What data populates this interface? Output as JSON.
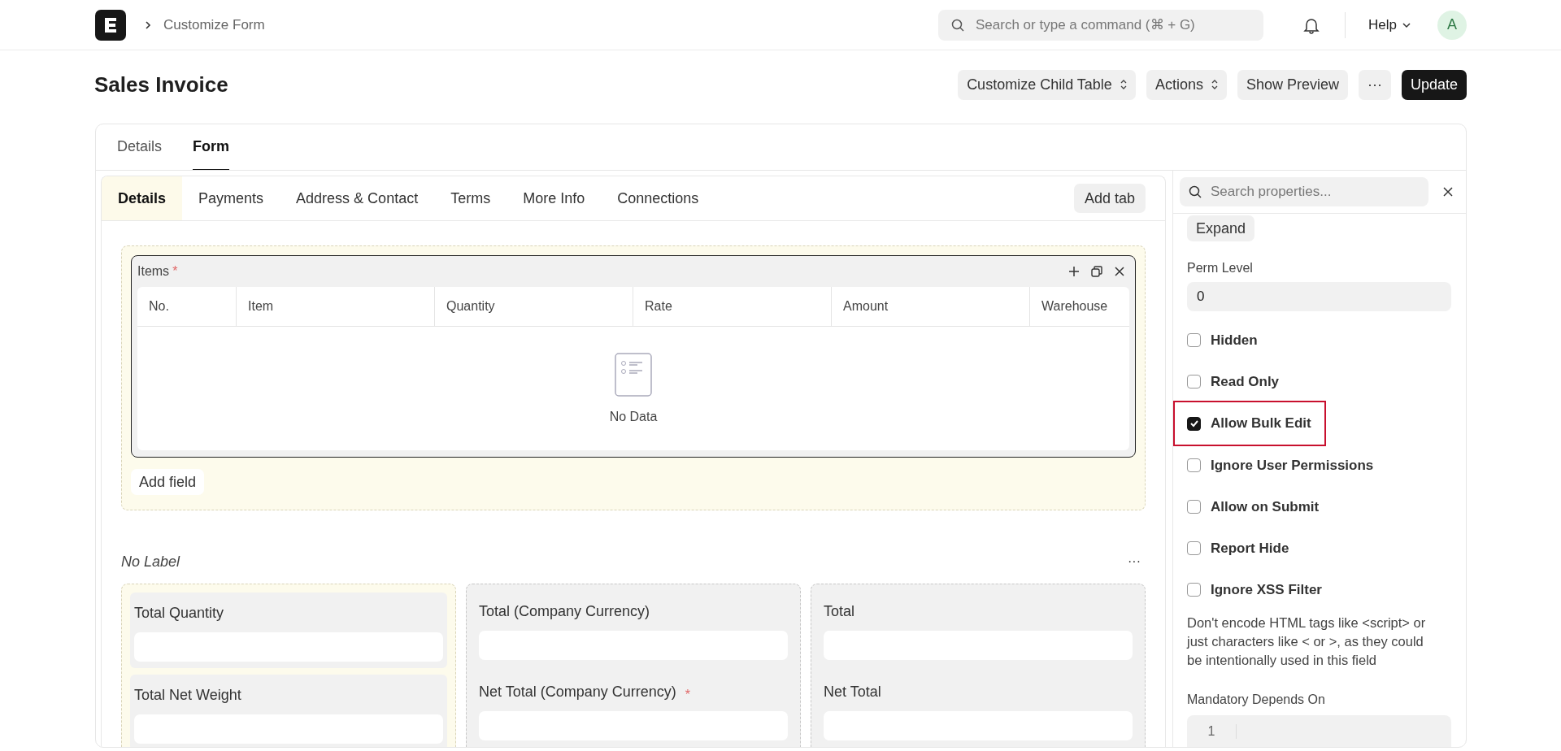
{
  "topbar": {
    "breadcrumb": "Customize Form",
    "search_placeholder": "Search or type a command (⌘ + G)",
    "help": "Help",
    "avatar": "A"
  },
  "header": {
    "title": "Sales Invoice",
    "buttons": [
      {
        "label": "Customize Child Table",
        "kind": "select"
      },
      {
        "label": "Actions",
        "kind": "select"
      },
      {
        "label": "Show Preview",
        "kind": "plain"
      },
      {
        "label": "···",
        "kind": "plain"
      },
      {
        "label": "Update",
        "kind": "primary"
      }
    ]
  },
  "page_tabs": [
    {
      "label": "Details",
      "selected": false
    },
    {
      "label": "Form",
      "selected": true
    }
  ],
  "form_tabs": [
    {
      "label": "Details",
      "selected": true
    },
    {
      "label": "Payments",
      "selected": false
    },
    {
      "label": "Address & Contact",
      "selected": false
    },
    {
      "label": "Terms",
      "selected": false
    },
    {
      "label": "More Info",
      "selected": false
    },
    {
      "label": "Connections",
      "selected": false
    }
  ],
  "add_tab": "Add tab",
  "items_table": {
    "label": "Items",
    "required_mark": "*",
    "columns": [
      "No.",
      "Item",
      "Quantity",
      "Rate",
      "Amount",
      "Warehouse"
    ],
    "empty_text": "No Data"
  },
  "add_field": "Add field",
  "section": {
    "label": "No Label",
    "menu": "···",
    "columns": [
      {
        "selected": true,
        "fields": [
          {
            "label": "Total Quantity"
          },
          {
            "label": "Total Net Weight"
          }
        ]
      },
      {
        "selected": false,
        "fields": [
          {
            "label": "Total (Company Currency)"
          },
          {
            "label": "Net Total (Company Currency)",
            "required_mark": "*"
          }
        ]
      },
      {
        "selected": false,
        "fields": [
          {
            "label": "Total"
          },
          {
            "label": "Net Total"
          }
        ]
      }
    ]
  },
  "properties": {
    "search_placeholder": "Search properties...",
    "expand": "Expand",
    "perm_level": {
      "label": "Perm Level",
      "value": "0"
    },
    "checks": [
      {
        "label": "Hidden",
        "checked": false,
        "highlighted": false
      },
      {
        "label": "Read Only",
        "checked": false,
        "highlighted": false
      },
      {
        "label": "Allow Bulk Edit",
        "checked": true,
        "highlighted": true
      },
      {
        "label": "Ignore User Permissions",
        "checked": false,
        "highlighted": false
      },
      {
        "label": "Allow on Submit",
        "checked": false,
        "highlighted": false
      },
      {
        "label": "Report Hide",
        "checked": false,
        "highlighted": false
      },
      {
        "label": "Ignore XSS Filter",
        "checked": false,
        "highlighted": false
      }
    ],
    "description": "Don't encode HTML tags like <script> or just characters like < or >, as they could be intentionally used in this field",
    "mandatory_depends_on": {
      "label": "Mandatory Depends On",
      "line_number": "1"
    }
  }
}
